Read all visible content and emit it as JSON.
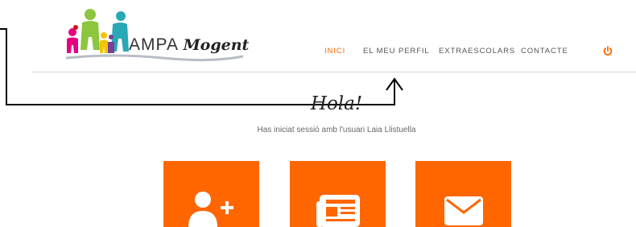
{
  "logo": {
    "text": "AMPA",
    "brand": "Mogent"
  },
  "nav": {
    "items": [
      {
        "label": "INICI",
        "active": true
      },
      {
        "label": "EL MEU PERFIL",
        "active": false
      },
      {
        "label": "EXTRAESCOLARS",
        "active": false
      },
      {
        "label": "CONTACTE",
        "active": false
      }
    ],
    "power_icon": "power-icon"
  },
  "main": {
    "greeting": "Hola!",
    "session_text": "Has iniciat sessió amb l'usuari Laia Llistuella"
  },
  "tiles": [
    {
      "icon": "add-user-icon"
    },
    {
      "icon": "newspaper-icon"
    },
    {
      "icon": "envelope-icon"
    }
  ],
  "colors": {
    "accent": "#ff6600",
    "nav_text": "#555555",
    "divider": "#d4d4d4"
  }
}
